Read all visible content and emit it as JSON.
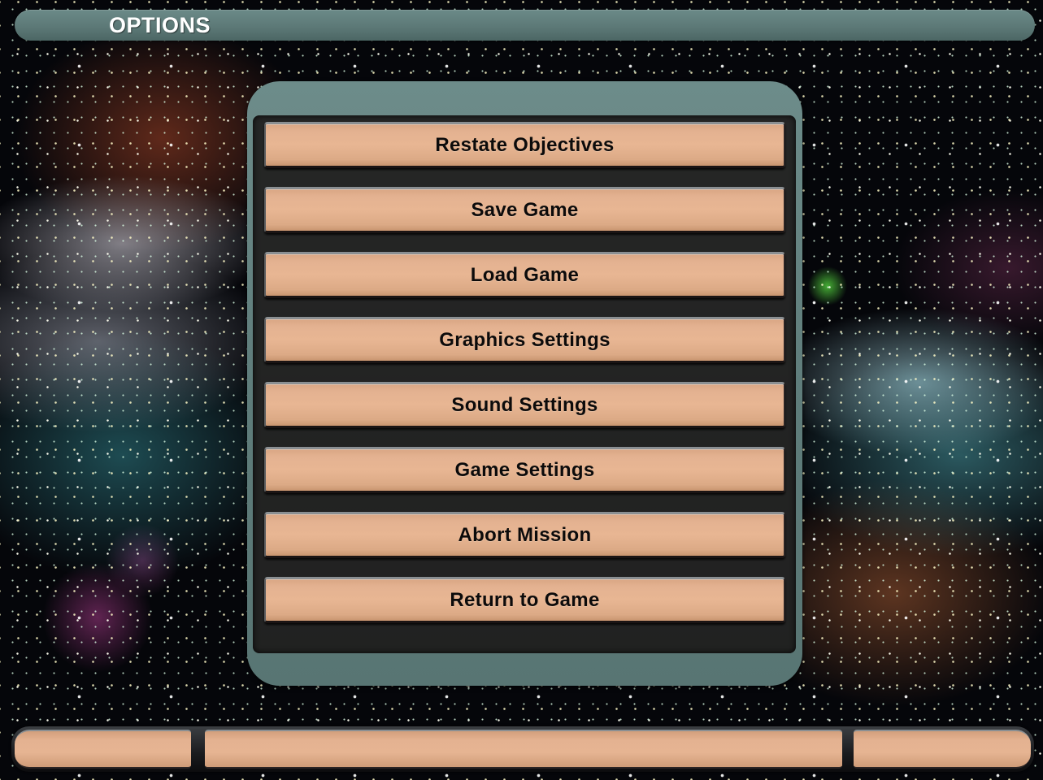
{
  "title_bar": {
    "title": "OPTIONS"
  },
  "menu": {
    "items": [
      {
        "label": "Restate Objectives"
      },
      {
        "label": "Save Game"
      },
      {
        "label": "Load Game"
      },
      {
        "label": "Graphics Settings"
      },
      {
        "label": "Sound Settings"
      },
      {
        "label": "Game Settings"
      },
      {
        "label": "Abort Mission"
      },
      {
        "label": "Return to Game"
      }
    ]
  },
  "status_bar": {
    "left": "",
    "center": "",
    "right": ""
  },
  "colors": {
    "panel_frame": "#5f7d7b",
    "button_face": "#e6b492",
    "button_text": "#0c0b0b",
    "title_text": "#ffffff"
  }
}
